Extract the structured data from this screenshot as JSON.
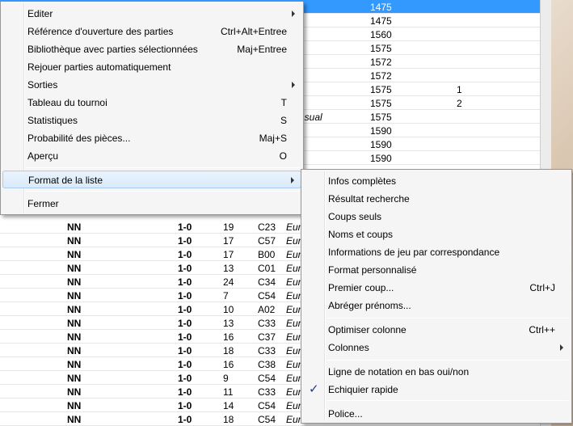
{
  "game_list": {
    "top_rows": [
      {
        "event": "ncia",
        "elo": "1475",
        "round": "",
        "selected": true
      },
      {
        "event": "sca",
        "elo": "1475",
        "round": ""
      },
      {
        "event": "e",
        "elo": "1560",
        "round": ""
      },
      {
        "event": "",
        "elo": "1575",
        "round": ""
      },
      {
        "event": "e",
        "elo": "1572",
        "round": ""
      },
      {
        "event": "e",
        "elo": "1572",
        "round": ""
      },
      {
        "event": "rid",
        "elo": "1575",
        "round": "1"
      },
      {
        "event": "rid",
        "elo": "1575",
        "round": "2"
      },
      {
        "event": "n casual",
        "elo": "1575",
        "round": ""
      },
      {
        "event": "e",
        "elo": "1590",
        "round": ""
      },
      {
        "event": "e",
        "elo": "1590",
        "round": ""
      },
      {
        "event": "e",
        "elo": "1590",
        "round": ""
      }
    ],
    "rows": [
      {
        "white": "NN",
        "result": "1-0",
        "moves": "19",
        "eco": "C23",
        "event": "Eur"
      },
      {
        "white": "NN",
        "result": "1-0",
        "moves": "17",
        "eco": "C57",
        "event": "Eur"
      },
      {
        "white": "NN",
        "result": "1-0",
        "moves": "17",
        "eco": "B00",
        "event": "Eur"
      },
      {
        "white": "NN",
        "result": "1-0",
        "moves": "13",
        "eco": "C01",
        "event": "Eur"
      },
      {
        "white": "NN",
        "result": "1-0",
        "moves": "24",
        "eco": "C34",
        "event": "Eur"
      },
      {
        "white": "NN",
        "result": "1-0",
        "moves": "7",
        "eco": "C54",
        "event": "Eur"
      },
      {
        "white": "NN",
        "result": "1-0",
        "moves": "10",
        "eco": "A02",
        "event": "Eur"
      },
      {
        "white": "NN",
        "result": "1-0",
        "moves": "13",
        "eco": "C33",
        "event": "Eur"
      },
      {
        "white": "NN",
        "result": "1-0",
        "moves": "16",
        "eco": "C37",
        "event": "Eur"
      },
      {
        "white": "NN",
        "result": "1-0",
        "moves": "18",
        "eco": "C33",
        "event": "Eur"
      },
      {
        "white": "NN",
        "result": "1-0",
        "moves": "16",
        "eco": "C38",
        "event": "Eur"
      },
      {
        "white": "NN",
        "result": "1-0",
        "moves": "9",
        "eco": "C54",
        "event": "Eur"
      },
      {
        "white": "NN",
        "result": "1-0",
        "moves": "11",
        "eco": "C33",
        "event": "Eur"
      },
      {
        "white": "NN",
        "result": "1-0",
        "moves": "14",
        "eco": "C54",
        "event": "Eur"
      },
      {
        "white": "NN",
        "result": "1-0",
        "moves": "18",
        "eco": "C54",
        "event": "Eur"
      }
    ]
  },
  "main_menu": {
    "items": [
      {
        "label": "Editer",
        "shortcut": "",
        "submenu": true
      },
      {
        "label": "Référence d'ouverture des parties",
        "shortcut": "Ctrl+Alt+Entree",
        "submenu": false
      },
      {
        "label": "Bibliothèque avec parties sélectionnées",
        "shortcut": "Maj+Entree",
        "submenu": false
      },
      {
        "label": "Rejouer parties automatiquement",
        "shortcut": "",
        "submenu": false
      },
      {
        "label": "Sorties",
        "shortcut": "",
        "submenu": true
      },
      {
        "label": "Tableau du tournoi",
        "shortcut": "T",
        "submenu": false
      },
      {
        "label": "Statistiques",
        "shortcut": "S",
        "submenu": false
      },
      {
        "label": "Probabilité des pièces...",
        "shortcut": "Maj+S",
        "submenu": false
      },
      {
        "label": "Aperçu",
        "shortcut": "O",
        "submenu": false
      },
      {
        "label": "Format de la liste",
        "shortcut": "",
        "submenu": true,
        "highlighted": true
      },
      {
        "label": "Fermer",
        "shortcut": "",
        "submenu": false
      }
    ]
  },
  "sub_menu": {
    "items": [
      {
        "label": "Infos complètes",
        "shortcut": ""
      },
      {
        "label": "Résultat recherche",
        "shortcut": ""
      },
      {
        "label": "Coups seuls",
        "shortcut": ""
      },
      {
        "label": "Noms et coups",
        "shortcut": ""
      },
      {
        "label": "Informations de jeu par correspondance",
        "shortcut": ""
      },
      {
        "label": "Format personnalisé",
        "shortcut": ""
      },
      {
        "label": "Premier coup...",
        "shortcut": "Ctrl+J"
      },
      {
        "label": "Abréger prénoms...",
        "shortcut": ""
      },
      {
        "label": "Optimiser colonne",
        "shortcut": "Ctrl++"
      },
      {
        "label": "Colonnes",
        "shortcut": "",
        "submenu": true
      },
      {
        "label": "Ligne de notation en bas oui/non",
        "shortcut": ""
      },
      {
        "label": "Echiquier rapide",
        "shortcut": "",
        "checked": true,
        "check_glyph": "✓"
      },
      {
        "label": "Police...",
        "shortcut": ""
      }
    ]
  }
}
